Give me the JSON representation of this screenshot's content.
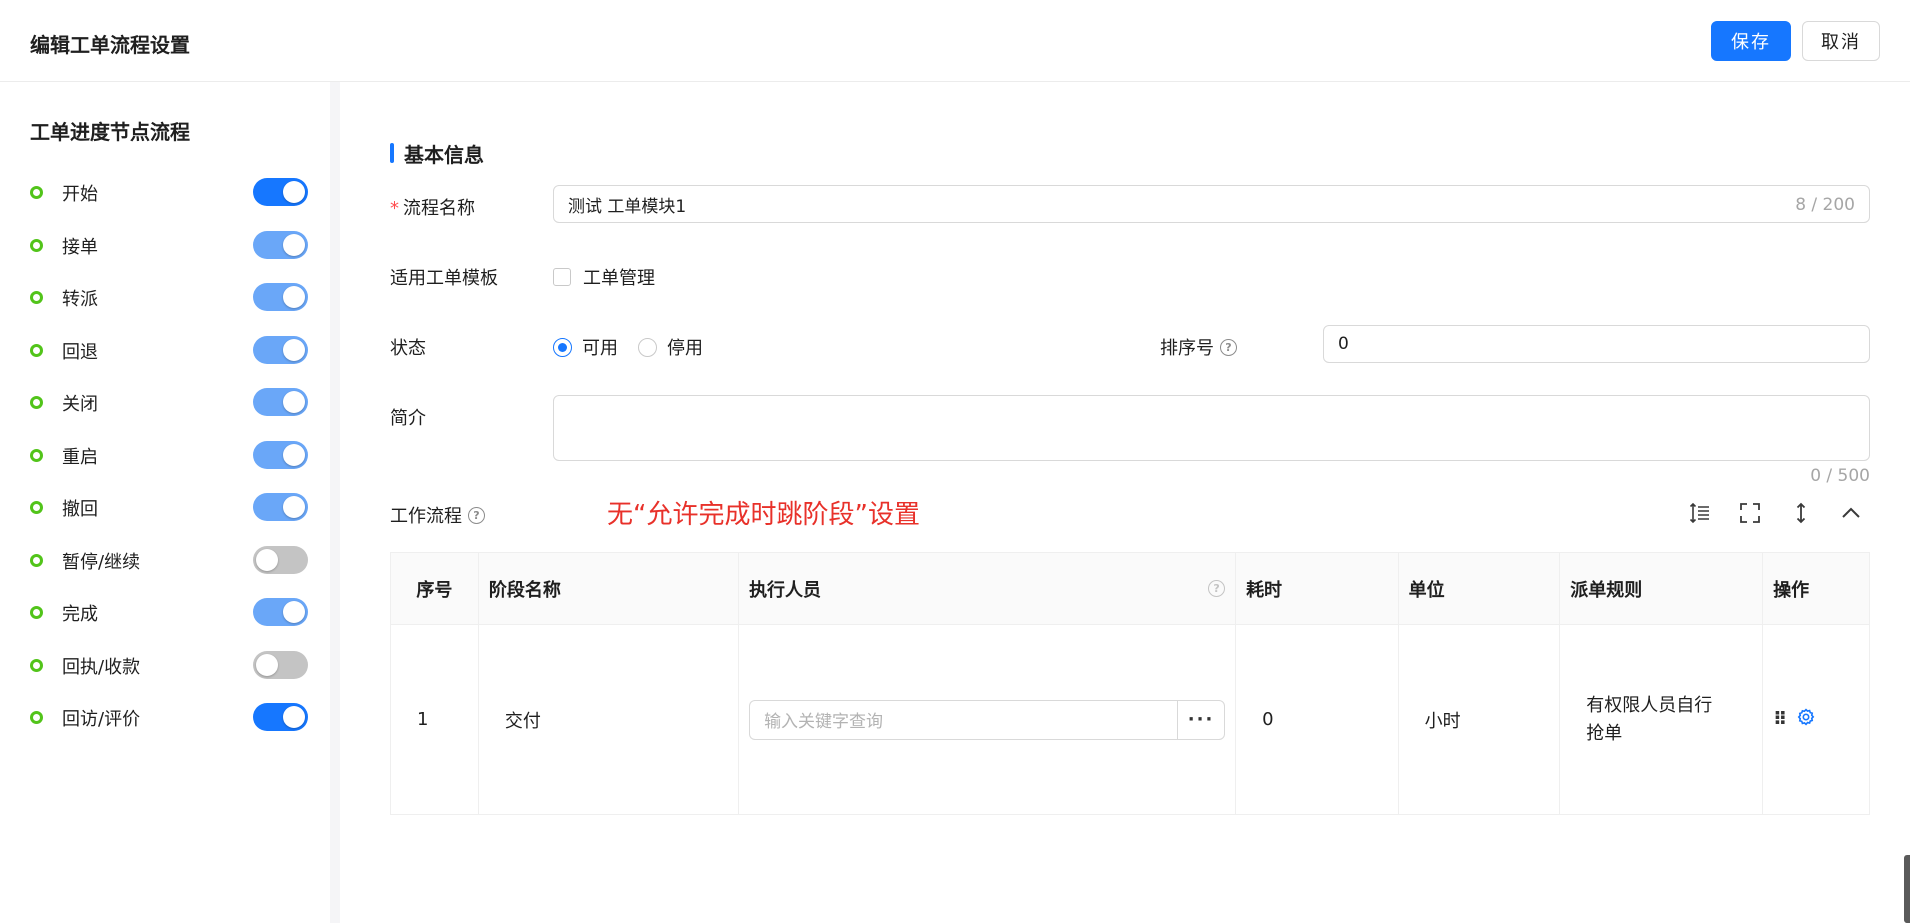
{
  "header": {
    "title": "编辑工单流程设置",
    "save_label": "保存",
    "cancel_label": "取消"
  },
  "sidebar": {
    "title": "工单进度节点流程",
    "nodes": [
      {
        "label": "开始",
        "enabled": true
      },
      {
        "label": "接单",
        "enabled": true
      },
      {
        "label": "转派",
        "enabled": true
      },
      {
        "label": "回退",
        "enabled": true
      },
      {
        "label": "关闭",
        "enabled": true
      },
      {
        "label": "重启",
        "enabled": true
      },
      {
        "label": "撤回",
        "enabled": true
      },
      {
        "label": "暂停/继续",
        "enabled": false
      },
      {
        "label": "完成",
        "enabled": true
      },
      {
        "label": "回执/收款",
        "enabled": false
      },
      {
        "label": "回访/评价",
        "enabled": true
      }
    ]
  },
  "basic": {
    "section_title": "基本信息",
    "name_label": "流程名称",
    "name_value": "测试 工单模块1",
    "name_counter": "8 / 200",
    "template_label": "适用工单模板",
    "template_option": "工单管理",
    "status_label": "状态",
    "status_enabled": "可用",
    "status_disabled": "停用",
    "sort_label": "排序号",
    "sort_value": "0",
    "intro_label": "简介",
    "intro_counter": "0 / 500"
  },
  "workflow": {
    "label": "工作流程",
    "annotation": "无“允许完成时跳阶段”设置",
    "columns": [
      "序号",
      "阶段名称",
      "执行人员",
      "耗时",
      "单位",
      "派单规则",
      "操作"
    ],
    "rows": [
      {
        "index": "1",
        "stage": "交付",
        "executor_placeholder": "输入关键字查询",
        "duration": "0",
        "unit": "小时",
        "rule": "有权限人员自行抢单"
      }
    ]
  },
  "colors": {
    "primary": "#1677ff",
    "node_dot": "#52c41a",
    "annotation": "#e8312a"
  }
}
